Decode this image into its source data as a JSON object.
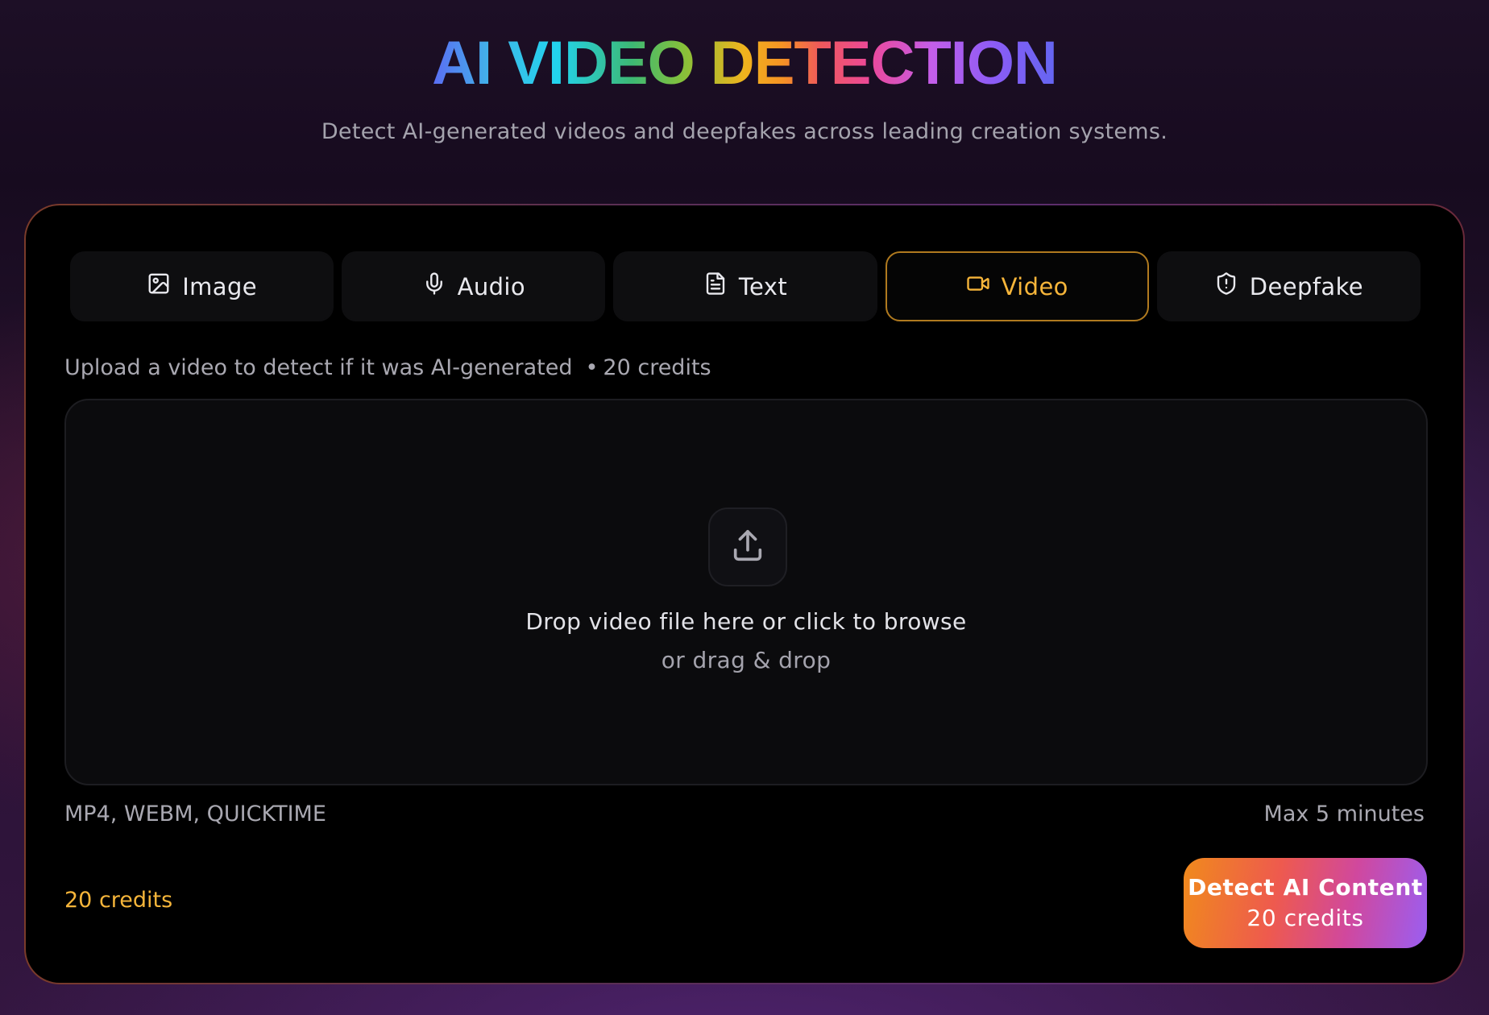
{
  "header": {
    "title": "AI VIDEO DETECTION",
    "subtitle": "Detect AI-generated videos and deepfakes across leading creation systems."
  },
  "tabs": [
    {
      "label": "Image",
      "icon": "image-icon",
      "active": false
    },
    {
      "label": "Audio",
      "icon": "microphone-icon",
      "active": false
    },
    {
      "label": "Text",
      "icon": "document-icon",
      "active": false
    },
    {
      "label": "Video",
      "icon": "video-camera-icon",
      "active": true
    },
    {
      "label": "Deepfake",
      "icon": "shield-alert-icon",
      "active": false
    }
  ],
  "upload": {
    "hint": "Upload a video to detect if it was AI-generated",
    "hint_bullet": "•",
    "hint_credits": "20 credits",
    "drop_main": "Drop video file here or click to browse",
    "drop_sub": "or drag & drop",
    "icon": "upload-icon",
    "formats": "MP4, WEBM, QUICKTIME",
    "max_length": "Max 5 minutes"
  },
  "footer": {
    "credits": "20 credits",
    "detect_label": "Detect AI Content",
    "detect_credits": "20 credits"
  },
  "colors": {
    "accent": "#f6b53a",
    "card_bg": "#000000",
    "tab_bg": "#0e0e10",
    "active_border": "#b07a1f"
  }
}
